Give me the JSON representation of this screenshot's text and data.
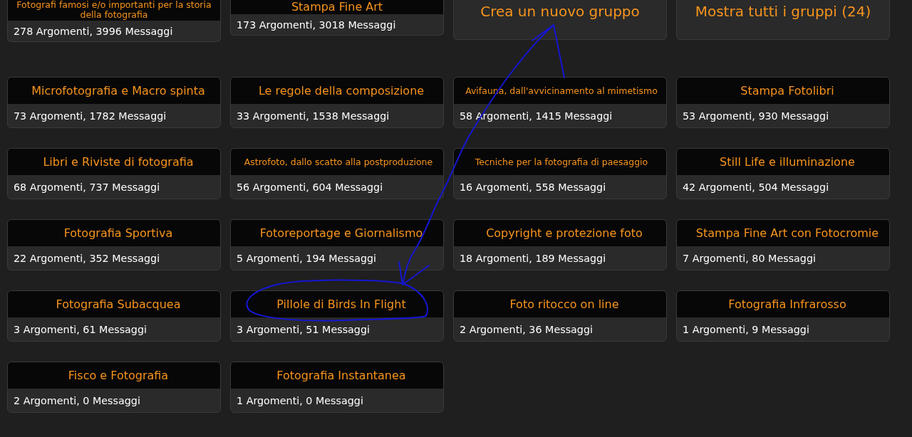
{
  "grid": [
    {
      "kind": "group",
      "title": "Fotografi famosi e/o importanti per la storia della fotografia",
      "stats": "278 Argomenti, 3996 Messaggi"
    },
    {
      "kind": "group",
      "title": "Stampa Fine Art",
      "stats": "173 Argomenti, 3018 Messaggi"
    },
    {
      "kind": "action",
      "label": "Crea un nuovo gruppo"
    },
    {
      "kind": "action",
      "label": "Mostra tutti i gruppi (24)"
    },
    {
      "kind": "group",
      "title": "Microfotografia e Macro spinta",
      "stats": "73 Argomenti, 1782 Messaggi"
    },
    {
      "kind": "group",
      "title": "Le regole della composizione",
      "stats": "33 Argomenti, 1538 Messaggi"
    },
    {
      "kind": "group",
      "title": "Avifauna, dall'avvicinamento al mimetismo",
      "stats": "58 Argomenti, 1415 Messaggi"
    },
    {
      "kind": "group",
      "title": "Stampa Fotolibri",
      "stats": "53 Argomenti, 930 Messaggi"
    },
    {
      "kind": "group",
      "title": "Libri e Riviste di fotografia",
      "stats": "68 Argomenti, 737 Messaggi"
    },
    {
      "kind": "group",
      "title": "Astrofoto, dallo scatto alla postproduzione",
      "stats": "56 Argomenti, 604 Messaggi"
    },
    {
      "kind": "group",
      "title": "Tecniche per la fotografia di paesaggio",
      "stats": "16 Argomenti, 558 Messaggi"
    },
    {
      "kind": "group",
      "title": "Still Life e illuminazione",
      "stats": "42 Argomenti, 504 Messaggi"
    },
    {
      "kind": "group",
      "title": "Fotografia Sportiva",
      "stats": "22 Argomenti, 352 Messaggi"
    },
    {
      "kind": "group",
      "title": "Fotoreportage e Giornalismo",
      "stats": "5 Argomenti, 194 Messaggi"
    },
    {
      "kind": "group",
      "title": "Copyright e protezione foto",
      "stats": "18 Argomenti, 189 Messaggi"
    },
    {
      "kind": "group",
      "title": "Stampa Fine Art con Fotocromie",
      "stats": "7 Argomenti, 80 Messaggi"
    },
    {
      "kind": "group",
      "title": "Fotografia Subacquea",
      "stats": "3 Argomenti, 61 Messaggi"
    },
    {
      "kind": "group",
      "title": "Pillole di Birds In Flight",
      "stats": "3 Argomenti, 51 Messaggi"
    },
    {
      "kind": "group",
      "title": "Foto ritocco on line",
      "stats": "2 Argomenti, 36 Messaggi"
    },
    {
      "kind": "group",
      "title": "Fotografia Infrarosso",
      "stats": "1 Argomenti, 9 Messaggi"
    },
    {
      "kind": "group",
      "title": "Fisco e Fotografia",
      "stats": "2 Argomenti, 0 Messaggi"
    },
    {
      "kind": "group",
      "title": "Fotografia Instantanea",
      "stats": "1 Argomenti, 0 Messaggi"
    }
  ]
}
